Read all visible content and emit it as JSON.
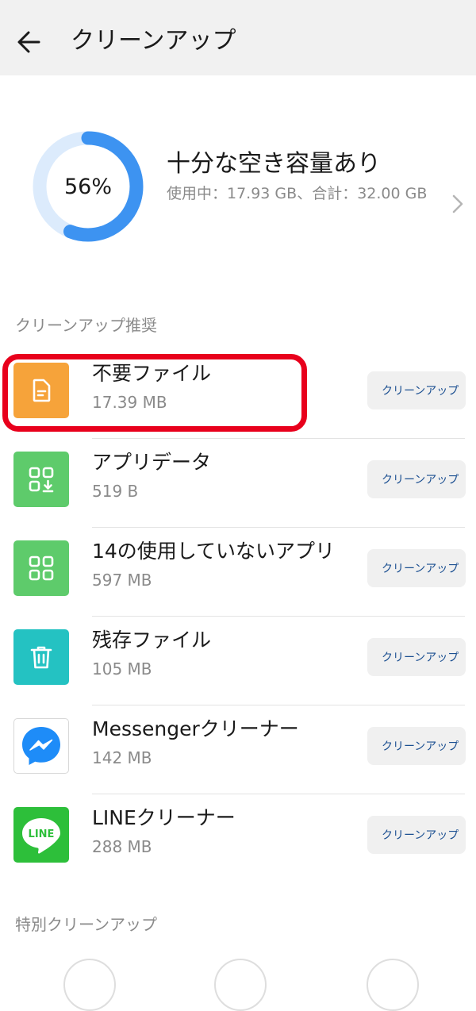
{
  "header": {
    "title": "クリーンアップ",
    "back_icon": "arrow-left-icon"
  },
  "storage": {
    "percent_label": "56%",
    "used_fraction": 0.56,
    "title": "十分な空き容量あり",
    "detail": "使用中：17.93 GB、合計：32.00 GB",
    "ring_color": "#3d93f1",
    "ring_track_color": "#dcebfc"
  },
  "sections": {
    "recommended": "クリーンアップ推奨",
    "special": "特別クリーンアップ"
  },
  "items": [
    {
      "title": "不要ファイル",
      "size": "17.39 MB",
      "button": "クリーンアップ",
      "icon": "document-icon",
      "color": "#f6a33a"
    },
    {
      "title": "アプリデータ",
      "size": "519 B",
      "button": "クリーンアップ",
      "icon": "app-data-download-icon",
      "color": "#5ecb6b"
    },
    {
      "title": "14の使用していないアプリ",
      "size": "597 MB",
      "button": "クリーンアップ",
      "icon": "apps-grid-icon",
      "color": "#5ecb6b"
    },
    {
      "title": "残存ファイル",
      "size": "105 MB",
      "button": "クリーンアップ",
      "icon": "trash-icon",
      "color": "#24c2c2"
    },
    {
      "title": "Messengerクリーナー",
      "size": "142 MB",
      "button": "クリーンアップ",
      "icon": "messenger-icon",
      "color": "#ffffff"
    },
    {
      "title": "LINEクリーナー",
      "size": "288 MB",
      "button": "クリーンアップ",
      "icon": "line-app-icon",
      "color": "#2dbf3a",
      "badge": "LINE"
    }
  ],
  "highlight_color": "#e8001c"
}
